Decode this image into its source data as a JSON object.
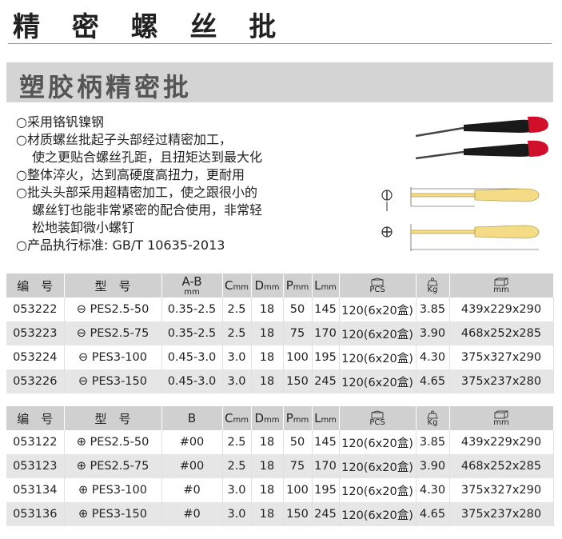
{
  "page_title": "精 密 螺 丝 批",
  "banner_title": "塑胶柄精密批",
  "features": [
    [
      "○采用铬钒镍钢"
    ],
    [
      "○材质螺丝批起子头部经过精密加工，",
      "使之更贴合螺丝孔距，且扭矩达到最大化"
    ],
    [
      "○整体淬火，达到高硬度高扭力，更耐用"
    ],
    [
      "○批头头部采用超精密加工，使之跟很小的",
      "螺丝钉也能非常紧密的配合使用，非常轻",
      "松地装卸微小螺钉"
    ],
    [
      "○产品执行标准: GB/T 10635-2013"
    ]
  ],
  "table1": {
    "headers": [
      "编　号",
      "型　号",
      "A-B",
      "mm",
      "C",
      "mm",
      "D",
      "mm",
      "P",
      "mm",
      "L",
      "mm",
      "PCS",
      "Kg",
      "mm"
    ],
    "rows": [
      [
        "053222",
        "⊖ PES2.5-50",
        "0.35-2.5",
        "2.5",
        "18",
        "50",
        "145",
        "120(6x20盒)",
        "3.85",
        "439x229x290"
      ],
      [
        "053223",
        "⊖ PES2.5-75",
        "0.35-2.5",
        "2.5",
        "18",
        "75",
        "170",
        "120(6x20盒)",
        "3.90",
        "468x252x285"
      ],
      [
        "053224",
        "⊖ PES3-100",
        "0.45-3.0",
        "3.0",
        "18",
        "100",
        "195",
        "120(6x20盒)",
        "4.30",
        "375x327x290"
      ],
      [
        "053226",
        "⊖ PES3-150",
        "0.45-3.0",
        "3.0",
        "18",
        "150",
        "245",
        "120(6x20盒)",
        "4.65",
        "375x237x280"
      ]
    ]
  },
  "table2": {
    "headers": [
      "编　号",
      "型　号",
      "B",
      "C",
      "mm",
      "D",
      "mm",
      "P",
      "mm",
      "L",
      "mm",
      "PCS",
      "Kg",
      "mm"
    ],
    "rows": [
      [
        "053122",
        "⊕ PES2.5-50",
        "#00",
        "2.5",
        "18",
        "50",
        "145",
        "120(6x20盒)",
        "3.85",
        "439x229x290"
      ],
      [
        "053123",
        "⊕ PES2.5-75",
        "#00",
        "2.5",
        "18",
        "75",
        "170",
        "120(6x20盒)",
        "3.90",
        "468x252x285"
      ],
      [
        "053134",
        "⊕ PES3-100",
        "#0",
        "3.0",
        "18",
        "100",
        "195",
        "120(6x20盒)",
        "4.30",
        "375x327x290"
      ],
      [
        "053136",
        "⊕ PES3-150",
        "#0",
        "3.0",
        "18",
        "150",
        "245",
        "120(6x20盒)",
        "4.65",
        "375x237x280"
      ]
    ]
  },
  "colors": {
    "handle_black": "#1a1a1a",
    "handle_red": "#d0102a",
    "header_gray": "#d0d0d0",
    "row_alt": "#e6e6e6",
    "diagram_yellow": "#f4dc86"
  },
  "icons": [
    "slotted-icon",
    "phillips-icon",
    "box-icon",
    "weight-icon",
    "carton-icon"
  ]
}
